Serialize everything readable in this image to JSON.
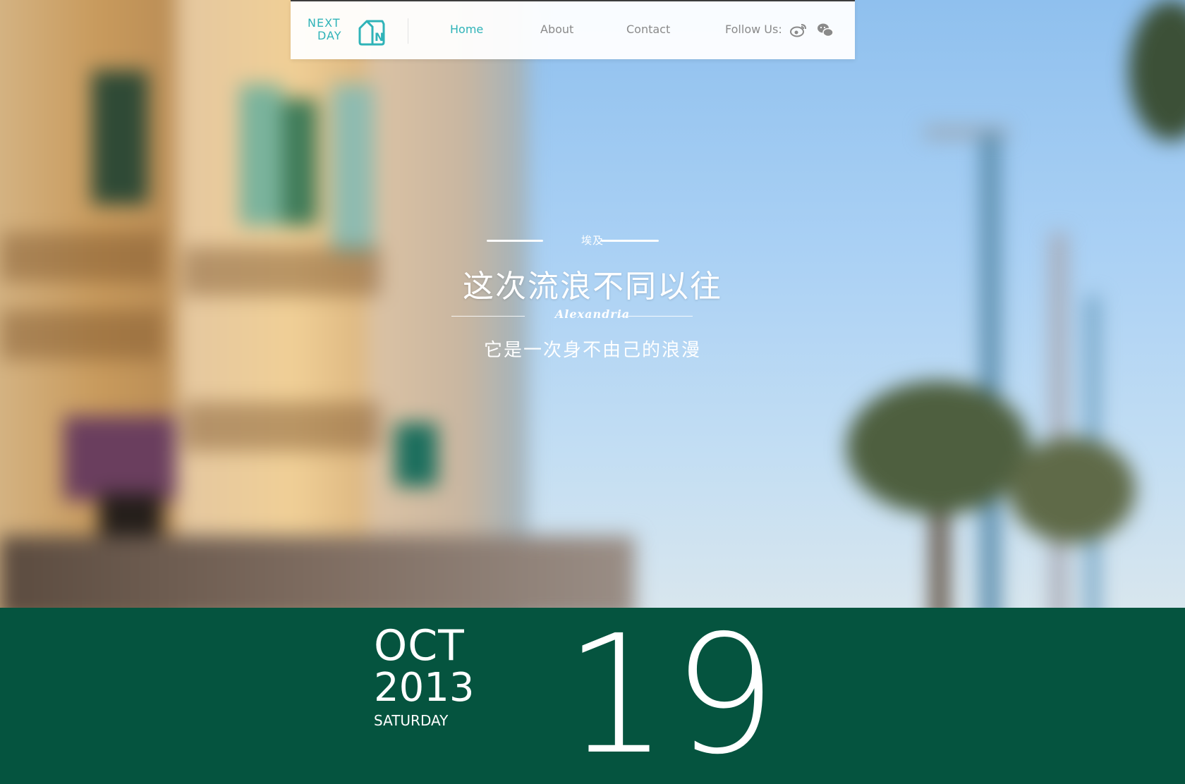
{
  "nav": {
    "logo_line1": "NEXT",
    "logo_line2": "DAY",
    "logo_mark": "N",
    "links": [
      "Home",
      "About",
      "Contact"
    ],
    "active": "Home",
    "follow_label": "Follow Us:",
    "social_icons": [
      "weibo-icon",
      "wechat-icon"
    ]
  },
  "hero": {
    "location_cn": "埃及",
    "title": "这次流浪不同以往",
    "location_en": "Alexandria",
    "subtitle": "它是一次身不由己的浪漫"
  },
  "date": {
    "month": "OCT",
    "year": "2013",
    "weekday": "SATURDAY",
    "day": "19"
  },
  "colors": {
    "accent": "#2fb3b8",
    "band": "#05543f",
    "nav_text": "#8a8a8a"
  }
}
